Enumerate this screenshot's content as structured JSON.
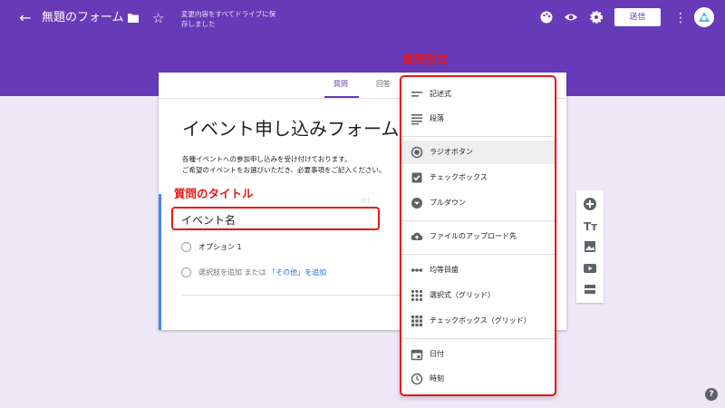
{
  "topbar": {
    "title": "無題のフォーム",
    "status": "変更内容をすべてドライブに保存しました",
    "send_label": "送信",
    "bg_color": "#673ab7",
    "icons": [
      "back-arrow-icon",
      "folder-icon",
      "star-icon",
      "palette-icon",
      "eye-icon",
      "gear-icon",
      "more-vert-icon",
      "avatar-icon"
    ]
  },
  "tabs": {
    "questions": "質問",
    "responses": "回答"
  },
  "form": {
    "title": "イベント申し込みフォーム",
    "description_line1": "各種イベントへの参加申し込みを受け付けております。",
    "description_line2": "ご希望のイベントをお選びいただき、必要事項をご記入ください。"
  },
  "question": {
    "title": "イベント名",
    "option1": "オプション 1",
    "add_option": "選択肢を追加",
    "or_text": "または",
    "add_other": "「その他」を追加"
  },
  "callouts": {
    "question_type": "質問形式",
    "question_title": "質問のタイトル"
  },
  "question_types": [
    {
      "label": "記述式",
      "icon": "short-text-icon"
    },
    {
      "label": "段落",
      "icon": "paragraph-icon"
    },
    {
      "label": "ラジオボタン",
      "icon": "radio-button-icon",
      "selected": true
    },
    {
      "label": "チェックボックス",
      "icon": "checkbox-icon"
    },
    {
      "label": "プルダウン",
      "icon": "dropdown-icon"
    },
    {
      "label": "ファイルのアップロード先",
      "icon": "cloud-upload-icon"
    },
    {
      "label": "均等目盛",
      "icon": "linear-scale-icon"
    },
    {
      "label": "選択式（グリッド）",
      "icon": "grid-icon"
    },
    {
      "label": "チェックボックス（グリッド）",
      "icon": "checkbox-grid-icon"
    },
    {
      "label": "日付",
      "icon": "calendar-icon"
    },
    {
      "label": "時刻",
      "icon": "clock-icon"
    }
  ],
  "side_tools": [
    "add-question-icon",
    "add-title-icon",
    "add-image-icon",
    "add-video-icon",
    "add-section-icon"
  ],
  "help": "?"
}
